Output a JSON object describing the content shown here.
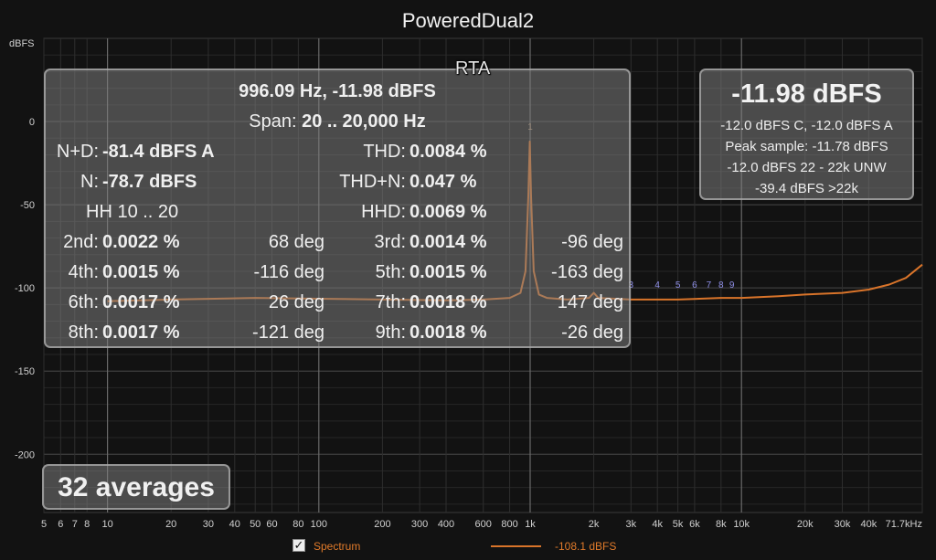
{
  "title": "PoweredDual2",
  "y_unit": "dBFS",
  "rta_label": "RTA",
  "cursor": "996.09 Hz, -11.98 dBFS",
  "span": {
    "label": "Span:",
    "value": "20 .. 20,000 Hz"
  },
  "measurements": {
    "nd": {
      "label": "N+D:",
      "value": "-81.4 dBFS A"
    },
    "n": {
      "label": "N:",
      "value": "-78.7 dBFS"
    },
    "hh": "HH 10 .. 20",
    "thd": {
      "label": "THD:",
      "value": "0.0084 %"
    },
    "thdn": {
      "label": "THD+N:",
      "value": "0.047 %"
    },
    "hhd": {
      "label": "HHD:",
      "value": "0.0069 %"
    }
  },
  "harmonics": [
    {
      "label": "2nd:",
      "value": "0.0022 %",
      "phase": "68 deg"
    },
    {
      "label": "3rd:",
      "value": "0.0014 %",
      "phase": "-96 deg"
    },
    {
      "label": "4th:",
      "value": "0.0015 %",
      "phase": "-116 deg"
    },
    {
      "label": "5th:",
      "value": "0.0015 %",
      "phase": "-163 deg"
    },
    {
      "label": "6th:",
      "value": "0.0017 %",
      "phase": "26 deg"
    },
    {
      "label": "7th:",
      "value": "0.0018 %",
      "phase": "147 deg"
    },
    {
      "label": "8th:",
      "value": "0.0017 %",
      "phase": "-121 deg"
    },
    {
      "label": "9th:",
      "value": "0.0018 %",
      "phase": "-26 deg"
    }
  ],
  "level_panel": {
    "big": "-11.98 dBFS",
    "lines": [
      "-12.0 dBFS C, -12.0 dBFS A",
      "Peak sample: -11.78 dBFS",
      "-12.0 dBFS 22 - 22k UNW",
      "-39.4 dBFS >22k"
    ]
  },
  "averages": "32 averages",
  "legend": {
    "checked": "✓",
    "name": "Spectrum",
    "value": "-108.1 dBFS",
    "color": "#d9742a"
  },
  "chart_data": {
    "type": "line",
    "title": "PoweredDual2",
    "ylabel": "dBFS",
    "xlabel": "",
    "x_scale": "log",
    "xlim": [
      5,
      71700
    ],
    "ylim": [
      -235,
      50
    ],
    "y_ticks": [
      0,
      -50,
      -100,
      -150,
      -200
    ],
    "x_ticks": [
      {
        "v": 5,
        "label": "5"
      },
      {
        "v": 6,
        "label": "6"
      },
      {
        "v": 7,
        "label": "7"
      },
      {
        "v": 8,
        "label": "8"
      },
      {
        "v": 10,
        "label": "10"
      },
      {
        "v": 20,
        "label": "20"
      },
      {
        "v": 30,
        "label": "30"
      },
      {
        "v": 40,
        "label": "40"
      },
      {
        "v": 50,
        "label": "50"
      },
      {
        "v": 60,
        "label": "60"
      },
      {
        "v": 80,
        "label": "80"
      },
      {
        "v": 100,
        "label": "100"
      },
      {
        "v": 200,
        "label": "200"
      },
      {
        "v": 300,
        "label": "300"
      },
      {
        "v": 400,
        "label": "400"
      },
      {
        "v": 600,
        "label": "600"
      },
      {
        "v": 800,
        "label": "800"
      },
      {
        "v": 1000,
        "label": "1k"
      },
      {
        "v": 2000,
        "label": "2k"
      },
      {
        "v": 3000,
        "label": "3k"
      },
      {
        "v": 4000,
        "label": "4k"
      },
      {
        "v": 5000,
        "label": "5k"
      },
      {
        "v": 6000,
        "label": "6k"
      },
      {
        "v": 8000,
        "label": "8k"
      },
      {
        "v": 10000,
        "label": "10k"
      },
      {
        "v": 20000,
        "label": "20k"
      },
      {
        "v": 30000,
        "label": "30k"
      },
      {
        "v": 40000,
        "label": "40k"
      },
      {
        "v": 71700,
        "label": "71.7kHz"
      }
    ],
    "harmonic_markers": [
      {
        "label": "1",
        "x": 1000
      },
      {
        "label": "3",
        "x": 3000
      },
      {
        "label": "4",
        "x": 4000
      },
      {
        "label": "5",
        "x": 5000
      },
      {
        "label": "6",
        "x": 6000
      },
      {
        "label": "7",
        "x": 7000
      },
      {
        "label": "8",
        "x": 8000
      },
      {
        "label": "9",
        "x": 9000
      }
    ],
    "series": [
      {
        "name": "Spectrum",
        "color": "#d9742a",
        "x": [
          10,
          20,
          50,
          100,
          200,
          400,
          600,
          800,
          900,
          950,
          980,
          996,
          1010,
          1040,
          1100,
          1200,
          1500,
          1900,
          2000,
          2100,
          3000,
          5000,
          8000,
          10000,
          15000,
          20000,
          30000,
          40000,
          50000,
          60000,
          71700
        ],
        "y": [
          -108,
          -107,
          -106,
          -106.5,
          -107,
          -107.5,
          -107,
          -106,
          -103,
          -90,
          -45,
          -12,
          -45,
          -90,
          -104,
          -106,
          -107,
          -106,
          -103,
          -106,
          -107,
          -107,
          -106,
          -106,
          -105,
          -104,
          -103,
          -101,
          -98,
          -94,
          -86
        ]
      }
    ]
  }
}
